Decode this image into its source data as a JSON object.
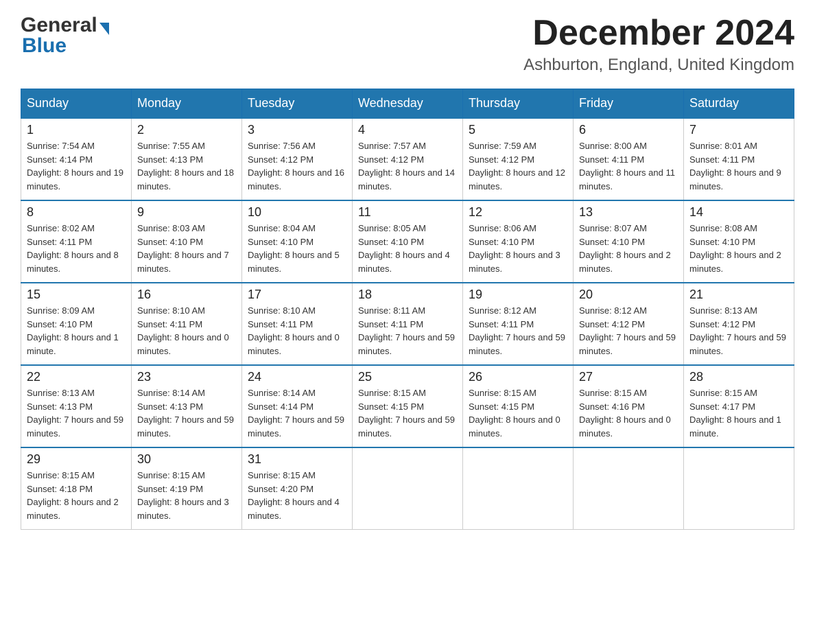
{
  "header": {
    "month_title": "December 2024",
    "location": "Ashburton, England, United Kingdom",
    "logo_general": "General",
    "logo_blue": "Blue"
  },
  "days_of_week": [
    "Sunday",
    "Monday",
    "Tuesday",
    "Wednesday",
    "Thursday",
    "Friday",
    "Saturday"
  ],
  "weeks": [
    [
      {
        "day": "1",
        "sunrise": "Sunrise: 7:54 AM",
        "sunset": "Sunset: 4:14 PM",
        "daylight": "Daylight: 8 hours and 19 minutes."
      },
      {
        "day": "2",
        "sunrise": "Sunrise: 7:55 AM",
        "sunset": "Sunset: 4:13 PM",
        "daylight": "Daylight: 8 hours and 18 minutes."
      },
      {
        "day": "3",
        "sunrise": "Sunrise: 7:56 AM",
        "sunset": "Sunset: 4:12 PM",
        "daylight": "Daylight: 8 hours and 16 minutes."
      },
      {
        "day": "4",
        "sunrise": "Sunrise: 7:57 AM",
        "sunset": "Sunset: 4:12 PM",
        "daylight": "Daylight: 8 hours and 14 minutes."
      },
      {
        "day": "5",
        "sunrise": "Sunrise: 7:59 AM",
        "sunset": "Sunset: 4:12 PM",
        "daylight": "Daylight: 8 hours and 12 minutes."
      },
      {
        "day": "6",
        "sunrise": "Sunrise: 8:00 AM",
        "sunset": "Sunset: 4:11 PM",
        "daylight": "Daylight: 8 hours and 11 minutes."
      },
      {
        "day": "7",
        "sunrise": "Sunrise: 8:01 AM",
        "sunset": "Sunset: 4:11 PM",
        "daylight": "Daylight: 8 hours and 9 minutes."
      }
    ],
    [
      {
        "day": "8",
        "sunrise": "Sunrise: 8:02 AM",
        "sunset": "Sunset: 4:11 PM",
        "daylight": "Daylight: 8 hours and 8 minutes."
      },
      {
        "day": "9",
        "sunrise": "Sunrise: 8:03 AM",
        "sunset": "Sunset: 4:10 PM",
        "daylight": "Daylight: 8 hours and 7 minutes."
      },
      {
        "day": "10",
        "sunrise": "Sunrise: 8:04 AM",
        "sunset": "Sunset: 4:10 PM",
        "daylight": "Daylight: 8 hours and 5 minutes."
      },
      {
        "day": "11",
        "sunrise": "Sunrise: 8:05 AM",
        "sunset": "Sunset: 4:10 PM",
        "daylight": "Daylight: 8 hours and 4 minutes."
      },
      {
        "day": "12",
        "sunrise": "Sunrise: 8:06 AM",
        "sunset": "Sunset: 4:10 PM",
        "daylight": "Daylight: 8 hours and 3 minutes."
      },
      {
        "day": "13",
        "sunrise": "Sunrise: 8:07 AM",
        "sunset": "Sunset: 4:10 PM",
        "daylight": "Daylight: 8 hours and 2 minutes."
      },
      {
        "day": "14",
        "sunrise": "Sunrise: 8:08 AM",
        "sunset": "Sunset: 4:10 PM",
        "daylight": "Daylight: 8 hours and 2 minutes."
      }
    ],
    [
      {
        "day": "15",
        "sunrise": "Sunrise: 8:09 AM",
        "sunset": "Sunset: 4:10 PM",
        "daylight": "Daylight: 8 hours and 1 minute."
      },
      {
        "day": "16",
        "sunrise": "Sunrise: 8:10 AM",
        "sunset": "Sunset: 4:11 PM",
        "daylight": "Daylight: 8 hours and 0 minutes."
      },
      {
        "day": "17",
        "sunrise": "Sunrise: 8:10 AM",
        "sunset": "Sunset: 4:11 PM",
        "daylight": "Daylight: 8 hours and 0 minutes."
      },
      {
        "day": "18",
        "sunrise": "Sunrise: 8:11 AM",
        "sunset": "Sunset: 4:11 PM",
        "daylight": "Daylight: 7 hours and 59 minutes."
      },
      {
        "day": "19",
        "sunrise": "Sunrise: 8:12 AM",
        "sunset": "Sunset: 4:11 PM",
        "daylight": "Daylight: 7 hours and 59 minutes."
      },
      {
        "day": "20",
        "sunrise": "Sunrise: 8:12 AM",
        "sunset": "Sunset: 4:12 PM",
        "daylight": "Daylight: 7 hours and 59 minutes."
      },
      {
        "day": "21",
        "sunrise": "Sunrise: 8:13 AM",
        "sunset": "Sunset: 4:12 PM",
        "daylight": "Daylight: 7 hours and 59 minutes."
      }
    ],
    [
      {
        "day": "22",
        "sunrise": "Sunrise: 8:13 AM",
        "sunset": "Sunset: 4:13 PM",
        "daylight": "Daylight: 7 hours and 59 minutes."
      },
      {
        "day": "23",
        "sunrise": "Sunrise: 8:14 AM",
        "sunset": "Sunset: 4:13 PM",
        "daylight": "Daylight: 7 hours and 59 minutes."
      },
      {
        "day": "24",
        "sunrise": "Sunrise: 8:14 AM",
        "sunset": "Sunset: 4:14 PM",
        "daylight": "Daylight: 7 hours and 59 minutes."
      },
      {
        "day": "25",
        "sunrise": "Sunrise: 8:15 AM",
        "sunset": "Sunset: 4:15 PM",
        "daylight": "Daylight: 7 hours and 59 minutes."
      },
      {
        "day": "26",
        "sunrise": "Sunrise: 8:15 AM",
        "sunset": "Sunset: 4:15 PM",
        "daylight": "Daylight: 8 hours and 0 minutes."
      },
      {
        "day": "27",
        "sunrise": "Sunrise: 8:15 AM",
        "sunset": "Sunset: 4:16 PM",
        "daylight": "Daylight: 8 hours and 0 minutes."
      },
      {
        "day": "28",
        "sunrise": "Sunrise: 8:15 AM",
        "sunset": "Sunset: 4:17 PM",
        "daylight": "Daylight: 8 hours and 1 minute."
      }
    ],
    [
      {
        "day": "29",
        "sunrise": "Sunrise: 8:15 AM",
        "sunset": "Sunset: 4:18 PM",
        "daylight": "Daylight: 8 hours and 2 minutes."
      },
      {
        "day": "30",
        "sunrise": "Sunrise: 8:15 AM",
        "sunset": "Sunset: 4:19 PM",
        "daylight": "Daylight: 8 hours and 3 minutes."
      },
      {
        "day": "31",
        "sunrise": "Sunrise: 8:15 AM",
        "sunset": "Sunset: 4:20 PM",
        "daylight": "Daylight: 8 hours and 4 minutes."
      },
      {
        "day": "",
        "sunrise": "",
        "sunset": "",
        "daylight": ""
      },
      {
        "day": "",
        "sunrise": "",
        "sunset": "",
        "daylight": ""
      },
      {
        "day": "",
        "sunrise": "",
        "sunset": "",
        "daylight": ""
      },
      {
        "day": "",
        "sunrise": "",
        "sunset": "",
        "daylight": ""
      }
    ]
  ]
}
